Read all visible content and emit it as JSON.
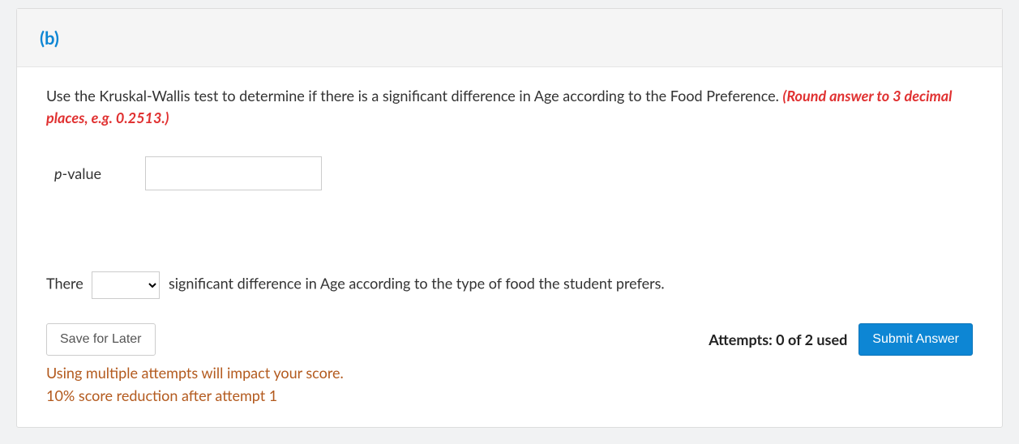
{
  "header": {
    "part_label": "(b)"
  },
  "question": {
    "text": "Use the Kruskal-Wallis test to determine if there is a significant difference in Age according to the Food Preference. ",
    "hint": "(Round answer to 3 decimal places, e.g. 0.2513.)"
  },
  "pvalue": {
    "label_prefix": "p",
    "label_suffix": "-value",
    "value": ""
  },
  "sentence": {
    "before": "There",
    "selected": "",
    "after": " significant difference in Age according to the type of food the student prefers."
  },
  "footer": {
    "save_label": "Save for Later",
    "attempts_text": "Attempts: 0 of 2 used",
    "submit_label": "Submit Answer",
    "impact_line1": "Using multiple attempts will impact your score.",
    "impact_line2": "10% score reduction after attempt 1"
  }
}
